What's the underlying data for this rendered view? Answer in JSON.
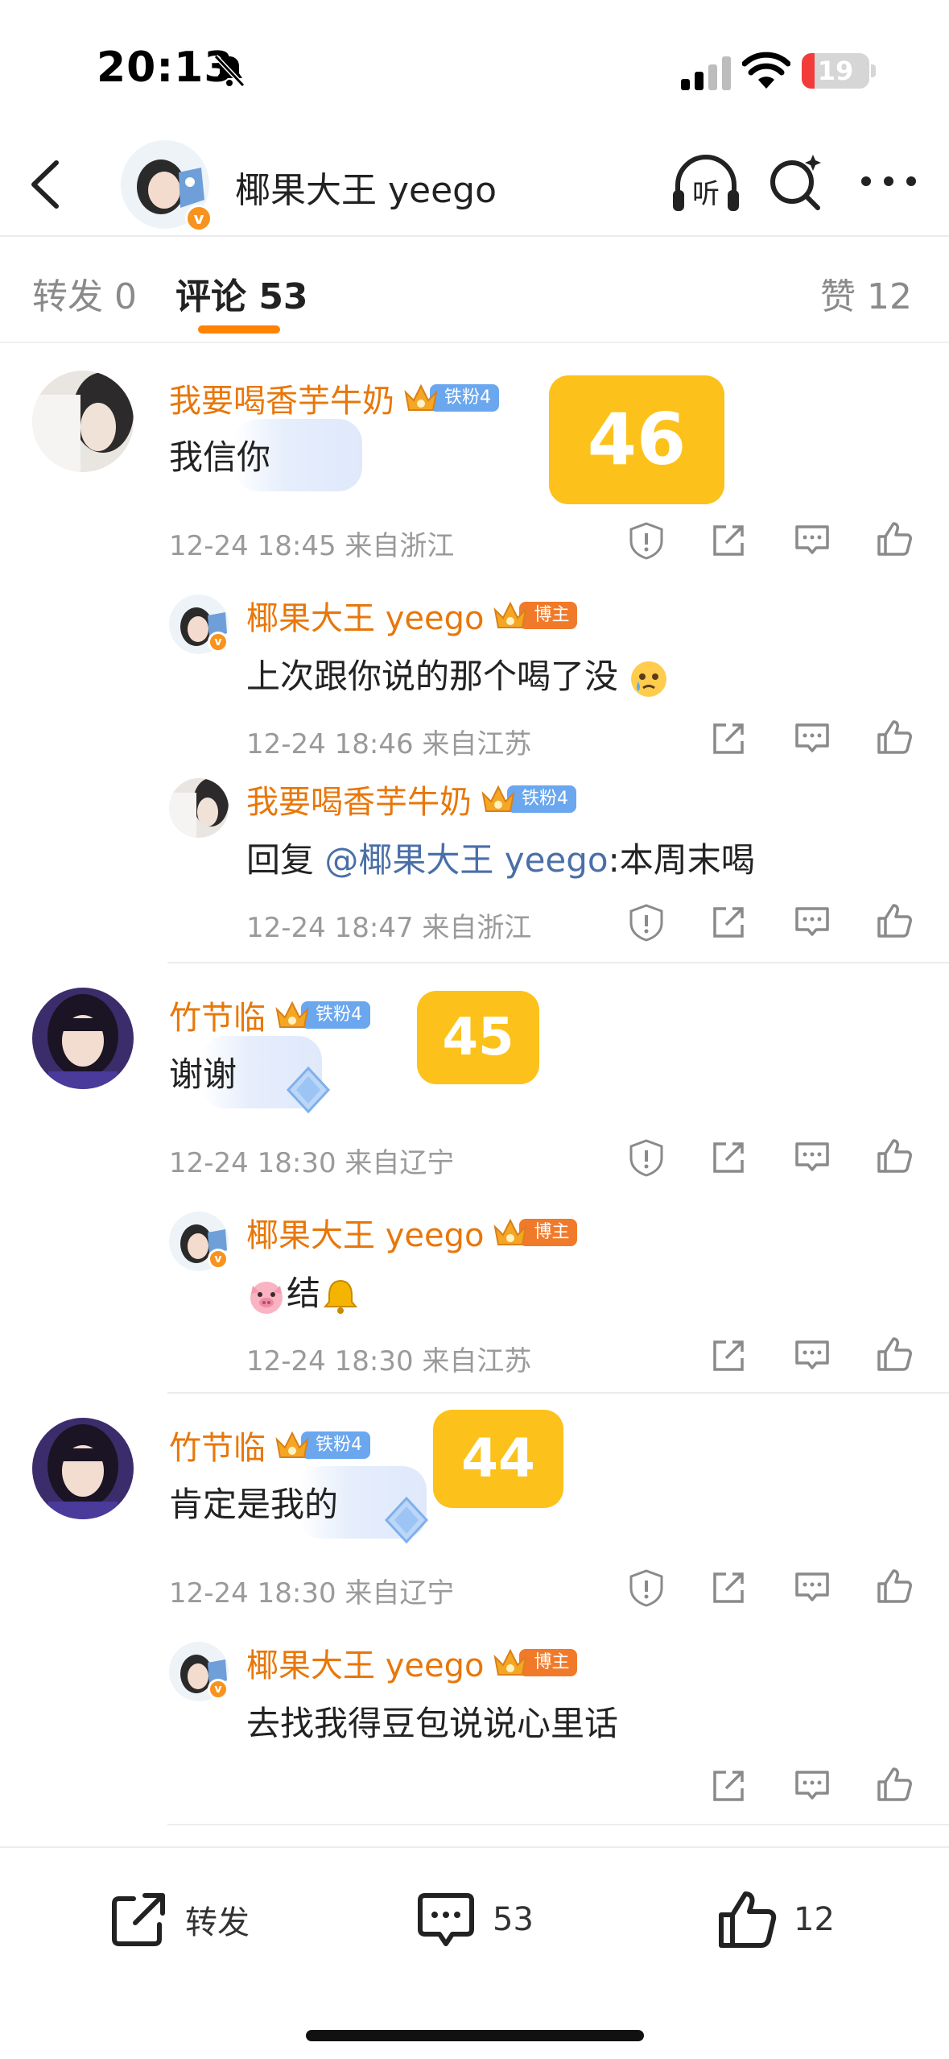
{
  "status_bar": {
    "time": "20:13",
    "battery": "19",
    "battery_level": 0.19
  },
  "nav": {
    "title": "椰果大王 yeego",
    "listen_glyph": "听"
  },
  "tabs": {
    "repost": "转发 0",
    "comments": "评论 53",
    "likes": "赞 12"
  },
  "comments": [
    {
      "user": "我要喝香芋牛奶",
      "badge": "铁粉4",
      "text": "我信你",
      "rank": "46",
      "time": "12-24 18:45",
      "location": "来自浙江",
      "replies": [
        {
          "user": "椰果大王 yeego",
          "badge": "博主",
          "text": "上次跟你说的那个喝了没",
          "time": "12-24 18:46",
          "location": "来自江苏"
        },
        {
          "user": "我要喝香芋牛奶",
          "badge": "铁粉4",
          "reply_prefix": "回复 ",
          "mention": "@椰果大王 yeego",
          "text_after": ":本周末喝",
          "time": "12-24 18:47",
          "location": "来自浙江"
        }
      ]
    },
    {
      "user": "竹节临",
      "badge": "铁粉4",
      "text": "谢谢",
      "rank": "45",
      "time": "12-24 18:30",
      "location": "来自辽宁",
      "replies": [
        {
          "user": "椰果大王 yeego",
          "badge": "博主",
          "text": "结",
          "time": "12-24 18:30",
          "location": "来自江苏"
        }
      ]
    },
    {
      "user": "竹节临",
      "badge": "铁粉4",
      "text": "肯定是我的",
      "rank": "44",
      "time": "12-24 18:30",
      "location": "来自辽宁",
      "replies": [
        {
          "user": "椰果大王 yeego",
          "badge": "博主",
          "text": "去找我得豆包说说心里话"
        }
      ]
    }
  ],
  "bottom_bar": {
    "repost": "转发",
    "comments": "53",
    "likes": "12"
  },
  "colors": {
    "accent": "#ff8200",
    "username": "#e8770a",
    "rank_badge": "#fcc21b",
    "fan_badge": "#6aa7ee",
    "host_badge": "#f07a2a",
    "mention": "#4a6fa8"
  },
  "icons": [
    "back-icon",
    "listen-icon",
    "search-icon",
    "more-icon",
    "report-icon",
    "share-icon",
    "reply-icon",
    "like-icon",
    "repost-icon",
    "comment-icon"
  ]
}
